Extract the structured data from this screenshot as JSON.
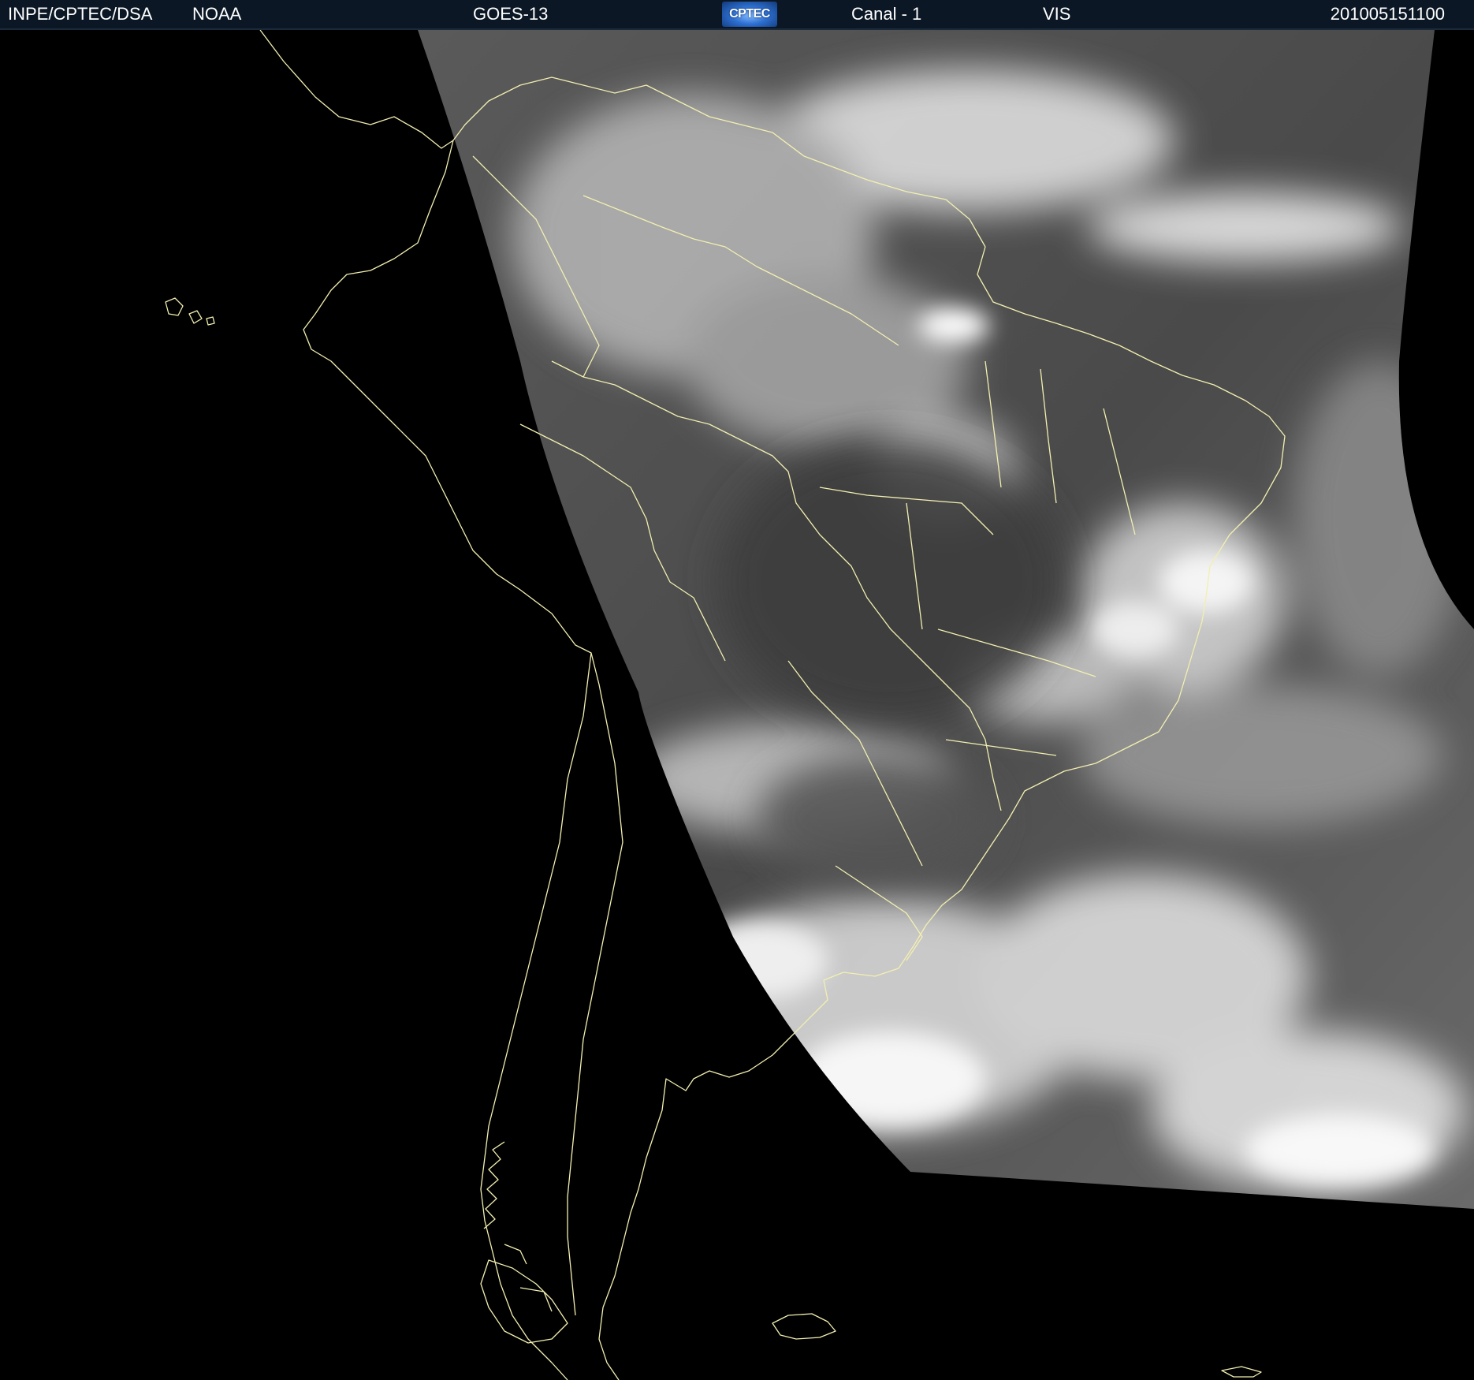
{
  "header": {
    "org": "INPE/CPTEC/DSA",
    "agency": "NOAA",
    "satellite": "GOES-13",
    "logo_text": "CPTEC",
    "channel": "Canal - 1",
    "band": "VIS",
    "timestamp": "201005151100"
  },
  "imagery": {
    "type": "visible-channel satellite image",
    "region": "South America",
    "coastline_color": "#f3efb0",
    "space_color": "#000000",
    "cloud_color": "#f2f2f2",
    "surface_color": "#4a4a4a"
  }
}
